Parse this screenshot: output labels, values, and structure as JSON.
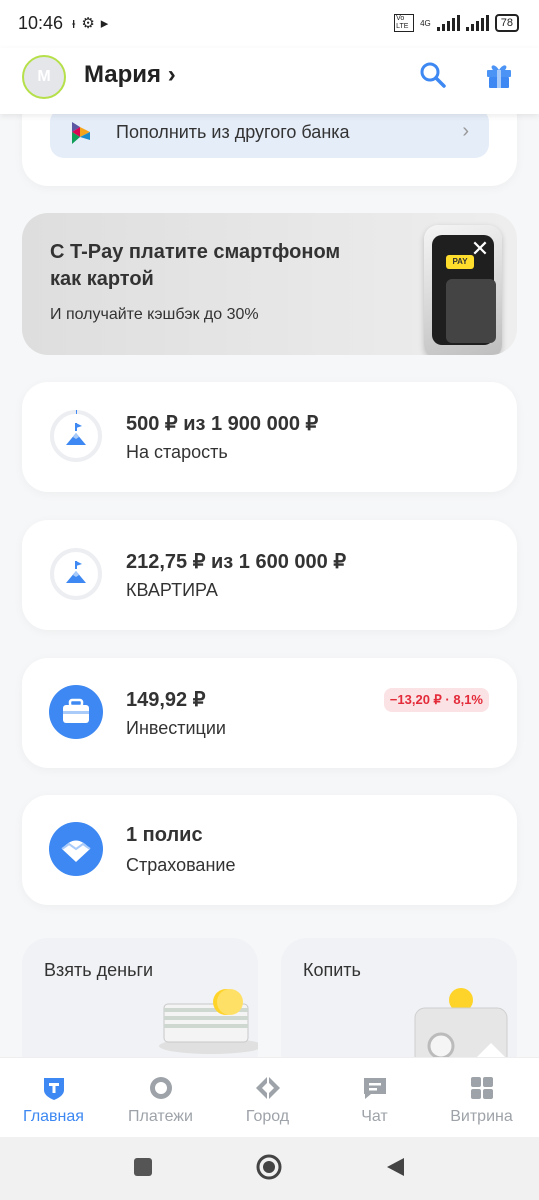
{
  "status_bar": {
    "time": "10:46",
    "network_label": "4G",
    "volte_label": "Vo LTE",
    "battery": "78"
  },
  "header": {
    "avatar_letter": "М",
    "user_name": "Мария",
    "chevron": "›",
    "search_icon": "search-icon",
    "gift_icon": "gift-icon"
  },
  "top_card": {
    "topup_label": "Пополнить из другого банка",
    "chevron": "›"
  },
  "promo": {
    "title": "С T-Pay платите смартфоном как картой",
    "subtitle": "И получайте кэшбэк до 30%",
    "phone_badge": "PAY",
    "close": "✕"
  },
  "accounts": [
    {
      "title": "500 ₽ из 1 900 000 ₽",
      "subtitle": "На старость",
      "icon": "goal-mountain-icon"
    },
    {
      "title": "212,75 ₽ из 1 600 000 ₽",
      "subtitle": "КВАРТИРА",
      "icon": "goal-mountain-icon"
    },
    {
      "title": "149,92 ₽",
      "subtitle": "Инвестиции",
      "icon": "briefcase-icon",
      "badge": "−13,20 ₽ · 8,1%"
    },
    {
      "title": "1 полис",
      "subtitle": "Страхование",
      "icon": "umbrella-shield-icon"
    }
  ],
  "tiles": {
    "loan": "Взять деньги",
    "save": "Копить"
  },
  "tabs": [
    {
      "label": "Главная",
      "icon": "home-t-icon"
    },
    {
      "label": "Платежи",
      "icon": "payments-icon"
    },
    {
      "label": "Город",
      "icon": "city-icon"
    },
    {
      "label": "Чат",
      "icon": "chat-icon"
    },
    {
      "label": "Витрина",
      "icon": "showcase-icon"
    }
  ],
  "colors": {
    "accent": "#3d88f2",
    "avatar_ring": "#b6e04a",
    "negative": "#e32b3a",
    "negative_bg": "#fbe2e4",
    "tpay_yellow": "#ffdd2d"
  }
}
